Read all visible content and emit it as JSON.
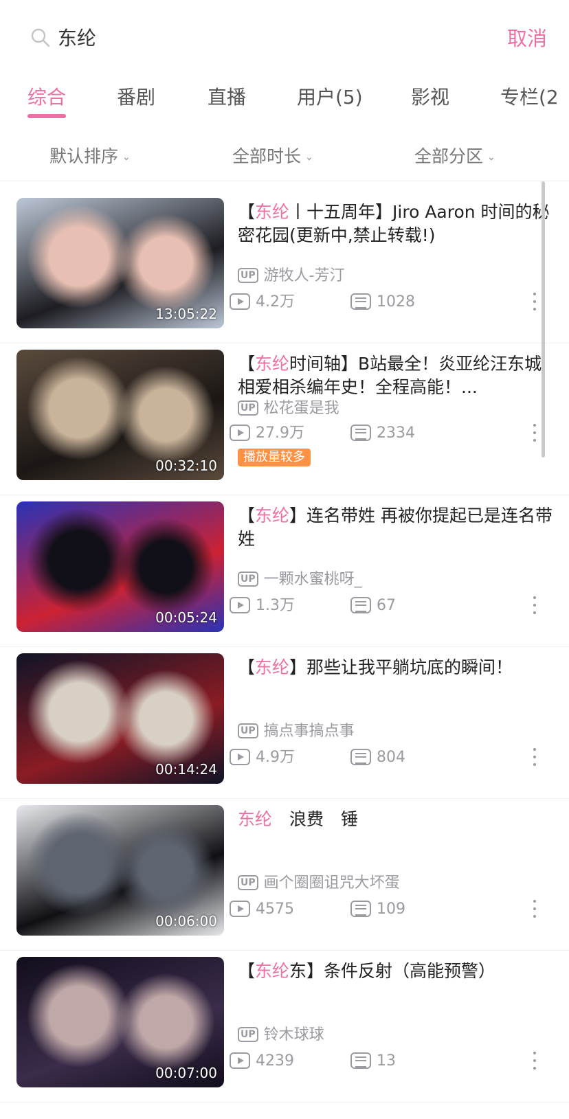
{
  "search": {
    "query": "东纶",
    "cancel_label": "取消"
  },
  "tabs": [
    {
      "label": "综合",
      "active": true
    },
    {
      "label": "番剧"
    },
    {
      "label": "直播"
    },
    {
      "label": "用户(5)"
    },
    {
      "label": "影视"
    },
    {
      "label": "专栏(2"
    }
  ],
  "filters": {
    "sort": "默认排序",
    "duration": "全部时长",
    "zone": "全部分区"
  },
  "colors": {
    "accent": "#ee6fa3",
    "badge": "#ff9146",
    "meta": "#9a9aa0"
  },
  "results": [
    {
      "title_pre": "【",
      "title_hl": "东纶",
      "title_post": "丨十五周年】Jiro Aaron 时间的秘密花园(更新中,禁止转载!)",
      "duration": "13:05:22",
      "uploader": "游牧人-芳汀",
      "views": "4.2万",
      "danmaku": "1028",
      "badge": "",
      "thumb_colors": [
        "#bcc7d6",
        "#1d1d22",
        "#e7c0b3"
      ]
    },
    {
      "title_pre": "【",
      "title_hl": "东纶",
      "title_post": "时间轴】B站最全！炎亚纶汪东城相爱相杀编年史！全程高能！...",
      "duration": "00:32:10",
      "uploader": "松花蛋是我",
      "views": "27.9万",
      "danmaku": "2334",
      "badge": "播放量较多",
      "thumb_colors": [
        "#5a4a3c",
        "#1b1715",
        "#c9b39a"
      ]
    },
    {
      "title_pre": "【",
      "title_hl": "东纶",
      "title_post": "】连名带姓 再被你提起已是连名带姓",
      "duration": "00:05:24",
      "uploader": "一颗水蜜桃呀_",
      "views": "1.3万",
      "danmaku": "67",
      "badge": "",
      "thumb_colors": [
        "#2a32b6",
        "#cc2233",
        "#111018"
      ]
    },
    {
      "title_pre": "【",
      "title_hl": "东纶",
      "title_post": "】那些让我平躺坑底的瞬间！",
      "duration": "00:14:24",
      "uploader": "搞点事搞点事",
      "views": "4.9万",
      "danmaku": "804",
      "badge": "",
      "thumb_colors": [
        "#0f1426",
        "#8a1c24",
        "#d8d0c4"
      ]
    },
    {
      "title_pre": "",
      "title_hl": "东纶",
      "title_post": "　浪费　锤",
      "duration": "00:06:00",
      "uploader": "画个圈圈诅咒大坏蛋",
      "views": "4575",
      "danmaku": "109",
      "badge": "",
      "thumb_colors": [
        "#e6e8ec",
        "#101014",
        "#5e6470"
      ]
    },
    {
      "title_pre": "【",
      "title_hl": "东纶",
      "title_post": "东】条件反射（高能预警）",
      "duration": "00:07:00",
      "uploader": "铃木球球",
      "views": "4239",
      "danmaku": "13",
      "badge": "",
      "thumb_colors": [
        "#120d1c",
        "#3a2c4a",
        "#c0a8a8"
      ]
    }
  ]
}
